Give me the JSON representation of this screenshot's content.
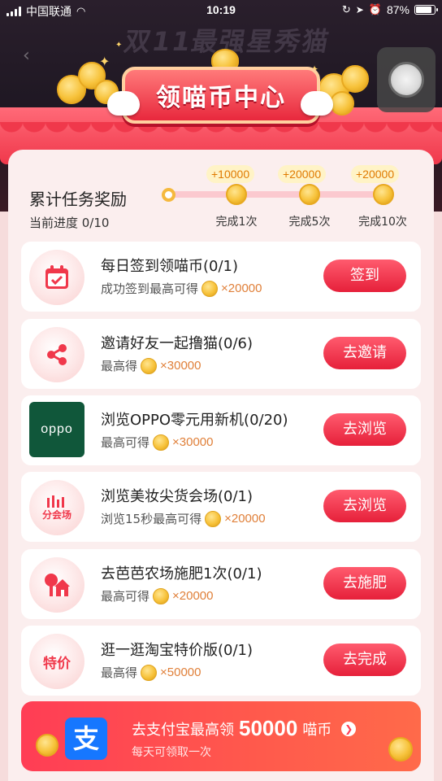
{
  "status_bar": {
    "carrier": "中国联通",
    "time": "10:19",
    "battery": "87%"
  },
  "header": {
    "background_slogan": "双11最强星秀猫",
    "title": "领喵币中心"
  },
  "progress": {
    "title": "累计任务奖励",
    "current_label": "当前进度 0/10",
    "milestones": [
      {
        "reward": "+10000",
        "label": "完成1次"
      },
      {
        "reward": "+20000",
        "label": "完成5次"
      },
      {
        "reward": "+20000",
        "label": "完成10次"
      }
    ]
  },
  "tasks": [
    {
      "icon": "calendar-check-icon",
      "title": "每日签到领喵币(0/1)",
      "sub_prefix": "成功签到最高可得",
      "reward": "×20000",
      "button": "签到"
    },
    {
      "icon": "share-icon",
      "title": "邀请好友一起撸猫(0/6)",
      "sub_prefix": "最高得",
      "reward": "×30000",
      "button": "去邀请"
    },
    {
      "icon": "oppo-logo",
      "logo_text": "oppo",
      "title": "浏览OPPO零元用新机(0/20)",
      "sub_prefix": "最高可得",
      "reward": "×30000",
      "button": "去浏览"
    },
    {
      "icon": "venue-icon",
      "icon_text": "分会场",
      "title": "浏览美妆尖货会场(0/1)",
      "sub_prefix": "浏览15秒最高可得",
      "reward": "×20000",
      "button": "去浏览"
    },
    {
      "icon": "farm-house-icon",
      "title": "去芭芭农场施肥1次(0/1)",
      "sub_prefix": "最高可得",
      "reward": "×20000",
      "button": "去施肥"
    },
    {
      "icon": "special-price-icon",
      "icon_text": "特价",
      "title": "逛一逛淘宝特价版(0/1)",
      "sub_prefix": "最高得",
      "reward": "×50000",
      "button": "去完成"
    }
  ],
  "banner": {
    "logo_char": "支",
    "title_prefix": "去支付宝最高领",
    "title_amount": "50000",
    "title_suffix": "喵币",
    "subtitle": "每天可领取一次"
  },
  "colors": {
    "accent": "#e6203a",
    "coin": "#f7c23a",
    "reward_text": "#e0803a",
    "alipay_blue": "#1677ff"
  }
}
